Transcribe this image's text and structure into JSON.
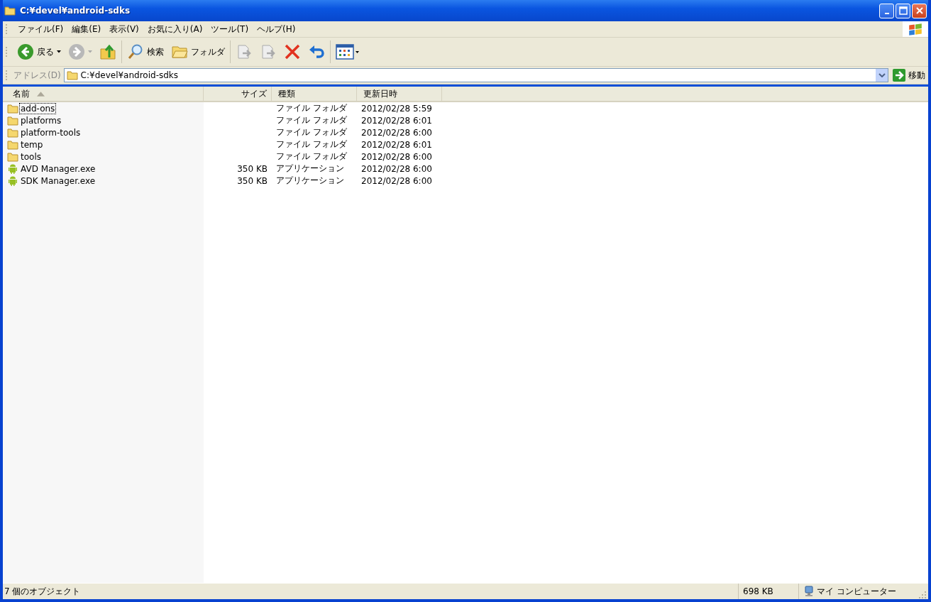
{
  "window": {
    "title": "C:¥devel¥android-sdks"
  },
  "menu": [
    "ファイル(F)",
    "編集(E)",
    "表示(V)",
    "お気に入り(A)",
    "ツール(T)",
    "ヘルプ(H)"
  ],
  "toolbar": [
    {
      "kind": "back",
      "label": "戻る",
      "disabled": false
    },
    {
      "kind": "forward",
      "disabled": true
    },
    {
      "kind": "up",
      "disabled": false
    },
    {
      "kind": "search",
      "label": "検索",
      "disabled": false
    },
    {
      "kind": "folders",
      "label": "フォルダ",
      "disabled": false
    },
    {
      "kind": "move",
      "disabled": true
    },
    {
      "kind": "copy",
      "disabled": true
    },
    {
      "kind": "delete",
      "disabled": false
    },
    {
      "kind": "undo",
      "disabled": false
    },
    {
      "kind": "views",
      "disabled": false
    }
  ],
  "address": {
    "label": "アドレス(D)",
    "value": "C:¥devel¥android-sdks",
    "go": "移動"
  },
  "columns": [
    {
      "label": "名前",
      "sorted": true
    },
    {
      "label": "サイズ",
      "sorted": false
    },
    {
      "label": "種類",
      "sorted": false
    },
    {
      "label": "更新日時",
      "sorted": false
    }
  ],
  "rows": [
    {
      "kind": "folder",
      "name": "add-ons",
      "type": "ファイル フォルダ",
      "modified": "2012/02/28 5:59",
      "focused": true
    },
    {
      "kind": "folder",
      "name": "platforms",
      "type": "ファイル フォルダ",
      "modified": "2012/02/28 6:01",
      "focused": false
    },
    {
      "kind": "folder",
      "name": "platform-tools",
      "type": "ファイル フォルダ",
      "modified": "2012/02/28 6:00",
      "focused": false
    },
    {
      "kind": "folder",
      "name": "temp",
      "type": "ファイル フォルダ",
      "modified": "2012/02/28 6:01",
      "focused": false
    },
    {
      "kind": "folder",
      "name": "tools",
      "type": "ファイル フォルダ",
      "modified": "2012/02/28 6:00",
      "focused": false
    },
    {
      "kind": "app",
      "name": "AVD Manager.exe",
      "size": "350 KB",
      "type": "アプリケーション",
      "modified": "2012/02/28 6:00",
      "focused": false
    },
    {
      "kind": "app",
      "name": "SDK Manager.exe",
      "size": "350 KB",
      "type": "アプリケーション",
      "modified": "2012/02/28 6:00",
      "focused": false
    }
  ],
  "status_bar": {
    "objects": "7 個のオブジェクト",
    "size": "698 KB",
    "zone": "マイ コンピューター"
  }
}
